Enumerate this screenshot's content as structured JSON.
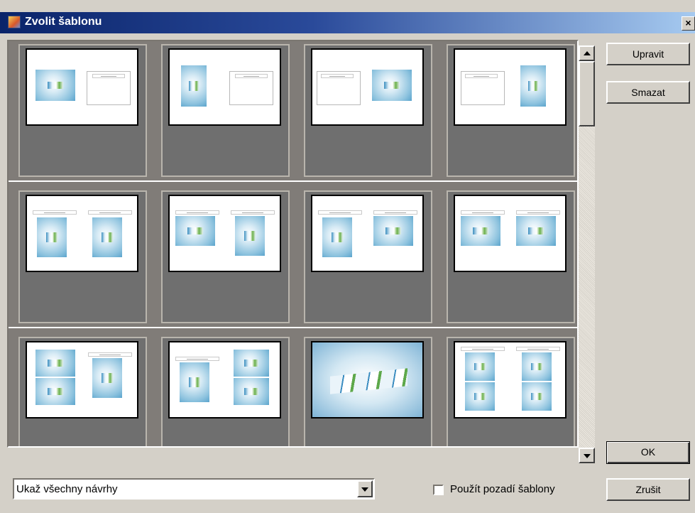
{
  "window": {
    "title": "Zvolit šablonu",
    "close_label": "×"
  },
  "buttons": {
    "edit": "Upravit",
    "delete": "Smazat",
    "ok": "OK",
    "cancel": "Zrušit"
  },
  "filter": {
    "selected": "Ukaž všechny návrhy"
  },
  "checkbox": {
    "label": "Použít pozadí šablony",
    "checked": false
  },
  "templates": [
    "template-1",
    "template-2",
    "template-3",
    "template-4",
    "template-5",
    "template-6",
    "template-7",
    "template-8",
    "template-9",
    "template-10",
    "template-11",
    "template-12"
  ],
  "colors": {
    "titlebar_start": "#0a246a",
    "titlebar_end": "#a6caf0",
    "grid_bg": "#807c78",
    "tile_bg": "#6f6f6f"
  }
}
